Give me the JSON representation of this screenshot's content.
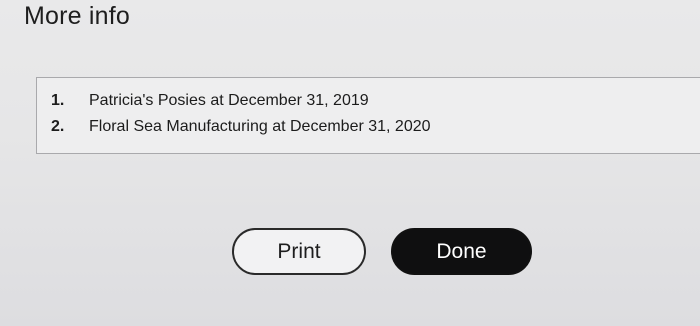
{
  "dialog": {
    "title": "More info"
  },
  "info_list": {
    "items": [
      {
        "number": "1.",
        "text": "Patricia's Posies at December 31, 2019"
      },
      {
        "number": "2.",
        "text": "Floral Sea Manufacturing at December 31, 2020"
      }
    ]
  },
  "buttons": {
    "print_label": "Print",
    "done_label": "Done"
  }
}
